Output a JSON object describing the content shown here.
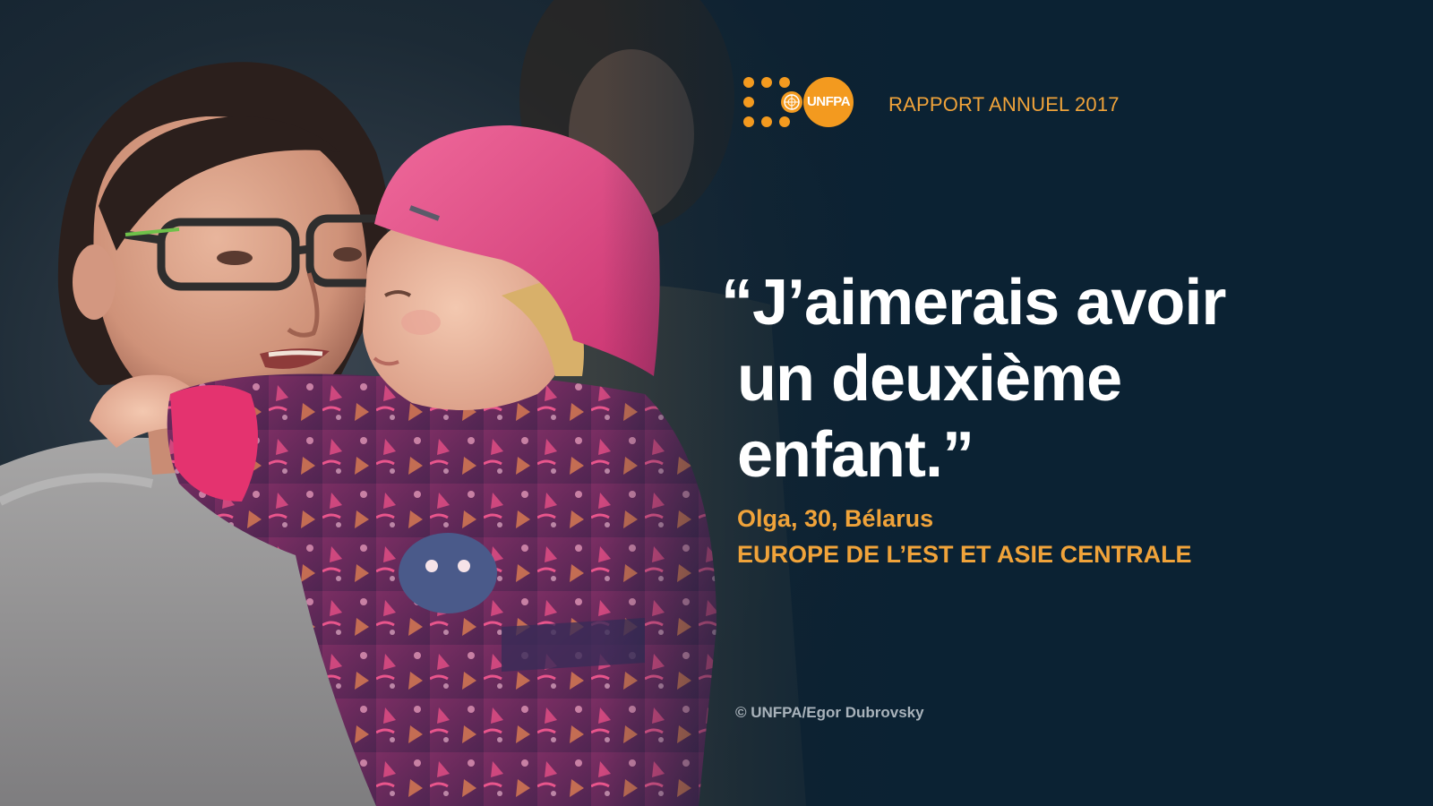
{
  "header": {
    "logo_text": "UNFPA",
    "report_title": "RAPPORT ANNUEL 2017"
  },
  "quote": {
    "line_1": "“J’aimerais avoir",
    "line_2": "un deuxième",
    "line_3": "enfant.”"
  },
  "attribution": {
    "speaker": "Olga, 30, Bélarus",
    "region": "EUROPE DE L’EST ET ASIE CENTRALE"
  },
  "credit": "© UNFPA/Egor Dubrovsky",
  "colors": {
    "background": "#0c2233",
    "accent_orange": "#f39a1f",
    "quote_text": "#ffffff",
    "credit_text": "#a9b3bb",
    "hat_pink": "#e03f7c",
    "jacket_purple": "#6a2b5f"
  },
  "icons": {
    "logo_emblem": "un-emblem-icon"
  }
}
